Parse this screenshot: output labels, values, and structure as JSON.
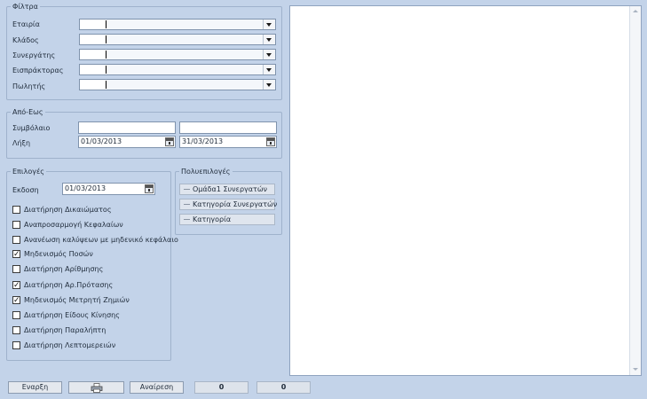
{
  "filters": {
    "title": "Φίλτρα",
    "fields": [
      {
        "label": "Εταιρία",
        "value": ""
      },
      {
        "label": "Κλάδος",
        "value": ""
      },
      {
        "label": "Συνεργάτης",
        "value": ""
      },
      {
        "label": "Εισπράκτορας",
        "value": ""
      },
      {
        "label": "Πωλητής",
        "value": ""
      }
    ]
  },
  "range": {
    "title": "Από-Εως",
    "contract_label": "Συμβόλαιο",
    "contract_from": "",
    "contract_to": "",
    "expiry_label": "Λήξη",
    "expiry_from": "01/03/2013",
    "expiry_to": "31/03/2013"
  },
  "options": {
    "title": "Επιλογές",
    "issue_label": "Εκδοση",
    "issue_date": "01/03/2013",
    "checkboxes": [
      {
        "label": "Διατήρηση Δικαιώματος",
        "checked": false,
        "mark": ""
      },
      {
        "label": "Αναπροσαρμογή Κεφαλαίων",
        "checked": false,
        "mark": ""
      },
      {
        "label": "Ανανέωση καλύψεων με μηδενικό κεφάλαιο",
        "checked": false,
        "mark": ""
      },
      {
        "label": "Μηδενισμός Ποσών",
        "checked": true,
        "mark": "✓"
      },
      {
        "label": "Διατήρηση Αρίθμησης",
        "checked": false,
        "mark": ""
      },
      {
        "label": "Διατήρηση Αρ.Πρότασης",
        "checked": true,
        "mark": "✓"
      },
      {
        "label": "Μηδενισμός Μετρητή Ζημιών",
        "checked": true,
        "mark": "✓"
      },
      {
        "label": "Διατήρηση Είδους Κίνησης",
        "checked": false,
        "mark": ""
      },
      {
        "label": "Διατήρηση Παραλήπτη",
        "checked": false,
        "mark": ""
      },
      {
        "label": "Διατήρηση Λεπτομερειών",
        "checked": false,
        "mark": ""
      }
    ]
  },
  "multi": {
    "title": "Πολυεπιλογές",
    "buttons": [
      {
        "label": "Ομάδα1 Συνεργατών"
      },
      {
        "label": "Κατηγορία Συνεργατών"
      },
      {
        "label": "Κατηγορία"
      }
    ]
  },
  "toolbar": {
    "start_label": "Εναρξη",
    "print_icon": "printer-icon",
    "cancel_label": "Αναίρεση",
    "counter1": "0",
    "counter2": "0"
  }
}
